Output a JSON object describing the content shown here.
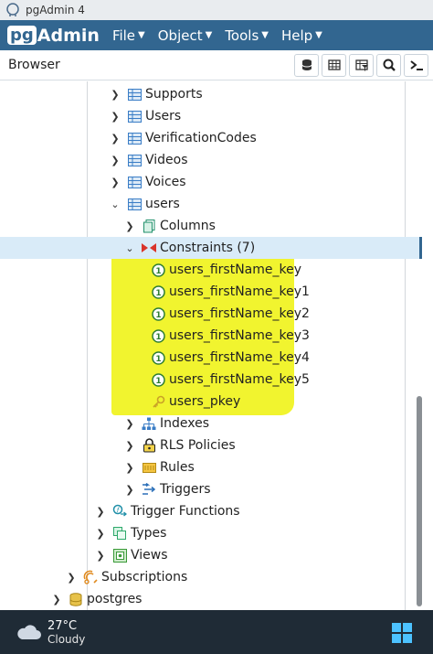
{
  "window": {
    "title": "pgAdmin 4"
  },
  "menu": {
    "logo_pg": "pg",
    "logo_admin": "Admin",
    "items": [
      {
        "label": "File"
      },
      {
        "label": "Object"
      },
      {
        "label": "Tools"
      },
      {
        "label": "Help"
      }
    ]
  },
  "toolbar": {
    "label": "Browser"
  },
  "tree": {
    "rows": [
      {
        "label": "Supports"
      },
      {
        "label": "Users"
      },
      {
        "label": "VerificationCodes"
      },
      {
        "label": "Videos"
      },
      {
        "label": "Voices"
      },
      {
        "label": "users"
      },
      {
        "label": "Columns"
      },
      {
        "label": "Constraints (7)"
      },
      {
        "label": "users_firstName_key"
      },
      {
        "label": "users_firstName_key1"
      },
      {
        "label": "users_firstName_key2"
      },
      {
        "label": "users_firstName_key3"
      },
      {
        "label": "users_firstName_key4"
      },
      {
        "label": "users_firstName_key5"
      },
      {
        "label": "users_pkey"
      },
      {
        "label": "Indexes"
      },
      {
        "label": "RLS Policies"
      },
      {
        "label": "Rules"
      },
      {
        "label": "Triggers"
      },
      {
        "label": "Trigger Functions"
      },
      {
        "label": "Types"
      },
      {
        "label": "Views"
      },
      {
        "label": "Subscriptions"
      },
      {
        "label": "postgres"
      }
    ]
  },
  "taskbar": {
    "temperature": "27°C",
    "condition": "Cloudy"
  },
  "colors": {
    "header": "#326690",
    "selection": "#d9ebf8",
    "highlighter": "#eef20a",
    "taskbar": "#1f2b36"
  }
}
